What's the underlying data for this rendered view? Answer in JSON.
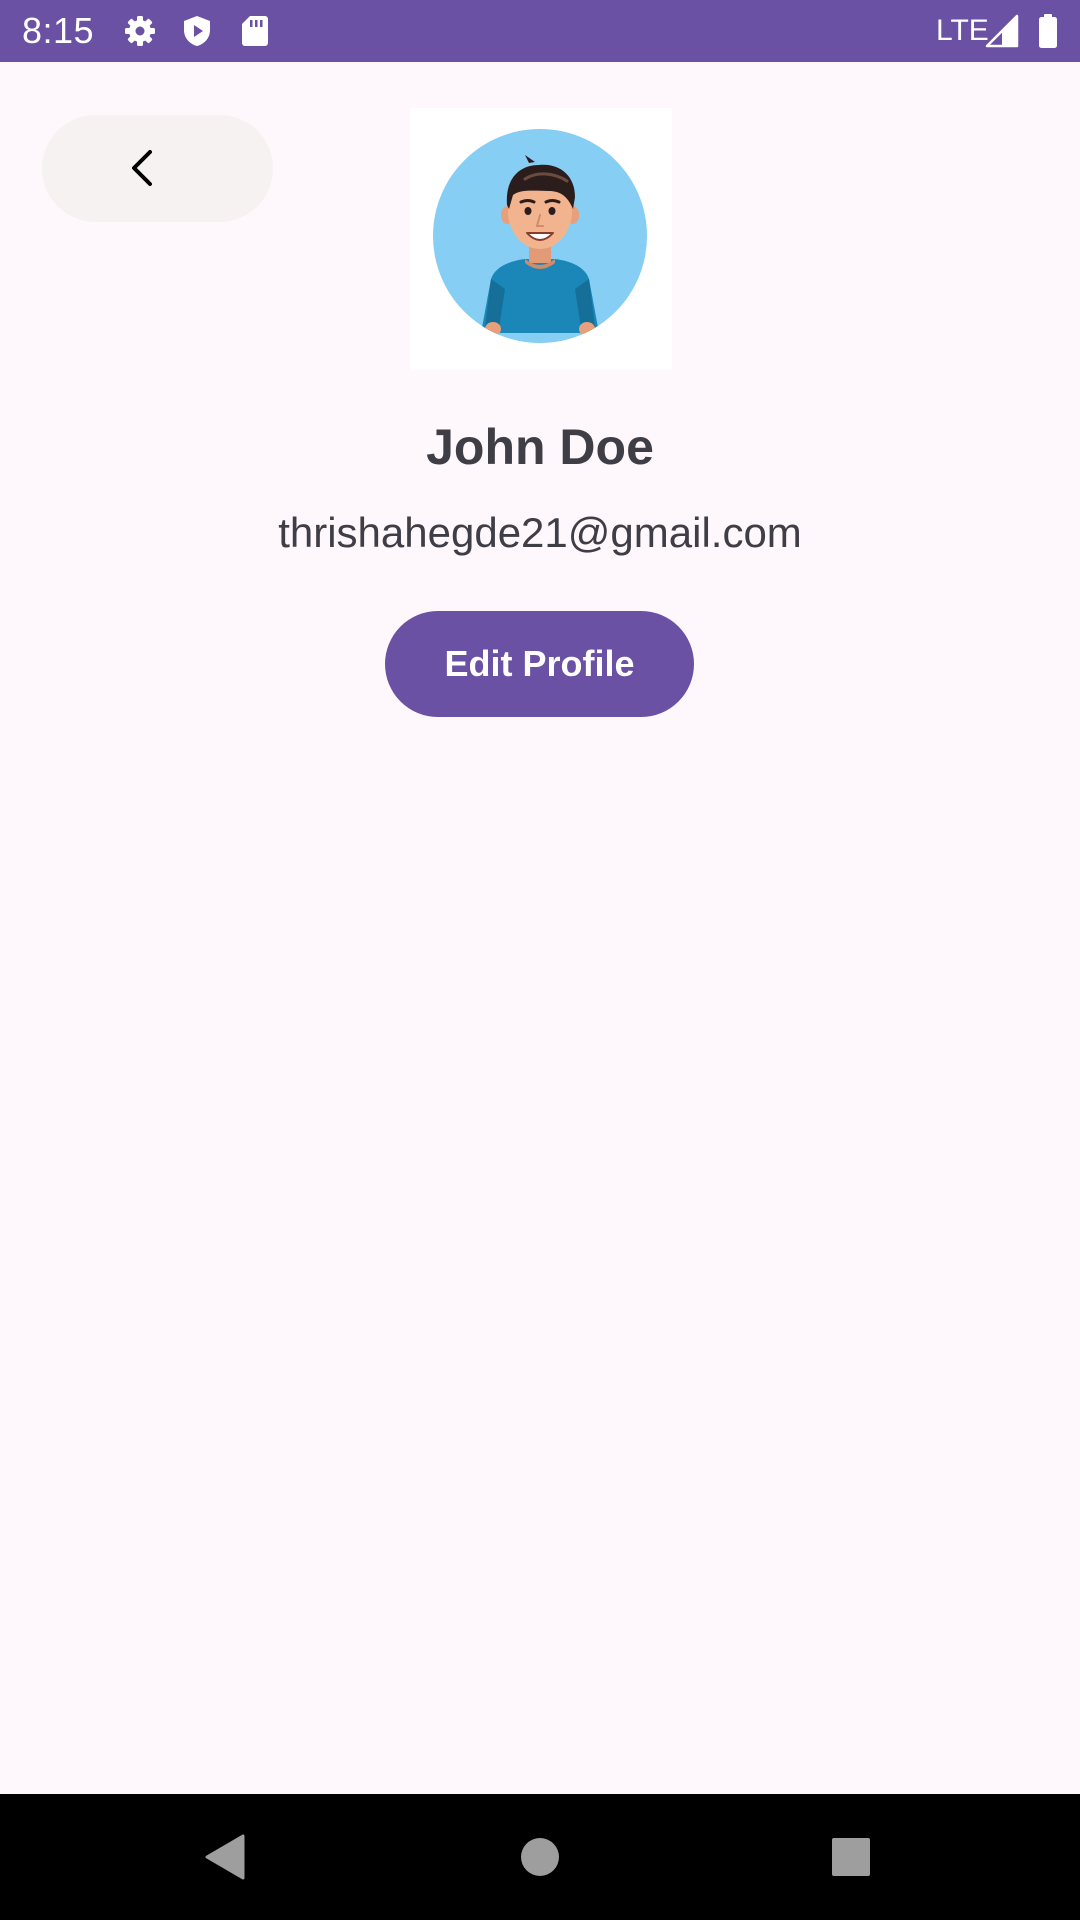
{
  "status_bar": {
    "time": "8:15",
    "network": "LTE",
    "background_color": "#6A51A3",
    "icons": [
      "settings-icon",
      "shield-play-icon",
      "sd-card-icon",
      "signal-icon",
      "battery-icon"
    ]
  },
  "header": {
    "back_icon": "chevron-left-icon"
  },
  "profile": {
    "avatar": "avatar-illustration",
    "name": "John Doe",
    "email": "thrishahegde21@gmail.com",
    "edit_button_label": "Edit Profile"
  },
  "theme": {
    "accent": "#6A51A3",
    "background": "#FEF7FC",
    "text": "#3F3D45"
  },
  "nav_bar": {
    "icons": [
      "back-triangle-icon",
      "home-circle-icon",
      "recents-square-icon"
    ]
  }
}
